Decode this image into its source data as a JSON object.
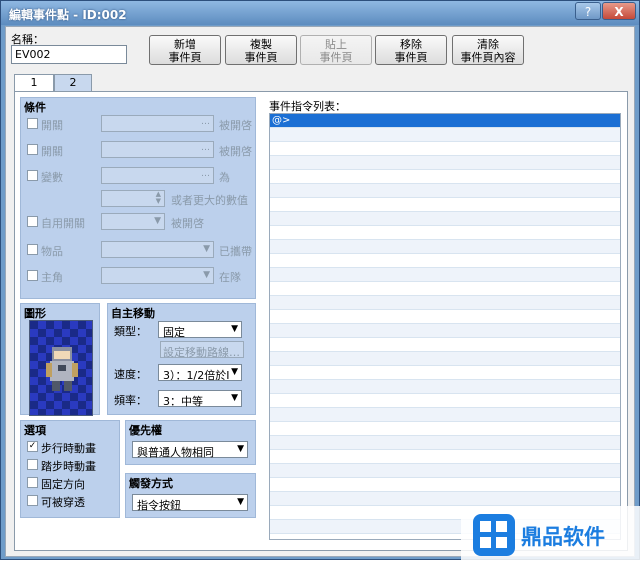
{
  "window": {
    "title": "編輯事件點 - ID:002",
    "help_label": "?",
    "close_label": "X"
  },
  "name_field": {
    "label": "名稱：",
    "value": "EV002"
  },
  "toolbar": {
    "new_page": [
      "新增",
      "事件頁"
    ],
    "copy_page": [
      "複製",
      "事件頁"
    ],
    "paste_page": [
      "貼上",
      "事件頁"
    ],
    "delete_page": [
      "移除",
      "事件頁"
    ],
    "clear_page": [
      "清除",
      "事件頁內容"
    ]
  },
  "tabs": [
    {
      "label": "1",
      "active": true
    },
    {
      "label": "2",
      "active": false
    }
  ],
  "conditions": {
    "title": "條件",
    "rows": [
      {
        "label": "開關",
        "suffix": "被開啓",
        "kind": "button"
      },
      {
        "label": "開關",
        "suffix": "被開啓",
        "kind": "button"
      },
      {
        "label": "變數",
        "suffix": "為",
        "kind": "button"
      },
      {
        "label": "",
        "suffix": "或者更大的數值",
        "kind": "spin"
      },
      {
        "label": "自用開關",
        "suffix": "被開啓",
        "kind": "combo"
      },
      {
        "label": "物品",
        "suffix": "已攜帶",
        "kind": "combo"
      },
      {
        "label": "主角",
        "suffix": "在隊",
        "kind": "combo"
      }
    ]
  },
  "graphic": {
    "title": "圖形"
  },
  "autonomous": {
    "title": "自主移動",
    "type_label": "類型：",
    "type_value": "固定",
    "route_button": "設定移動路線…",
    "speed_label": "速度：",
    "speed_value": "3）：1/2倍於I",
    "freq_label": "頻率：",
    "freq_value": "3：中等"
  },
  "options": {
    "title": "選項",
    "items": [
      {
        "label": "步行時動畫",
        "checked": true
      },
      {
        "label": "踏步時動畫",
        "checked": false
      },
      {
        "label": "固定方向",
        "checked": false
      },
      {
        "label": "可被穿透",
        "checked": false
      }
    ]
  },
  "priority": {
    "title": "優先權",
    "value": "與普通人物相同"
  },
  "trigger": {
    "title": "觸發方式",
    "value": "指令按鈕"
  },
  "command_list": {
    "title": "事件指令列表：",
    "first_row": "@>"
  },
  "watermark": {
    "text": "鼎品软件",
    "color": "#1b7de0"
  }
}
